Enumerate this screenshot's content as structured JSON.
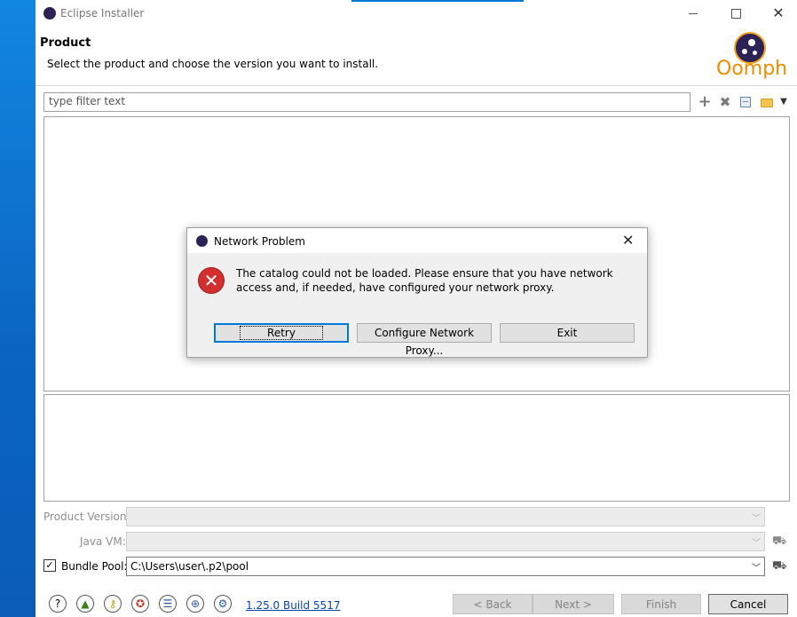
{
  "window": {
    "title": "Eclipse Installer"
  },
  "header": {
    "title": "Product",
    "description": "Select the product and choose the version you want to install.",
    "logo_text": "Oomph"
  },
  "filter": {
    "placeholder": "type filter text"
  },
  "fields": {
    "product_version_label": "Product Version:",
    "java_vm_label": "Java VM:",
    "bundle_pool_label": "Bundle Pool:",
    "bundle_pool_value": "C:\\Users\\user\\.p2\\pool",
    "bundle_pool_checked": true
  },
  "footer": {
    "version_link": "1.25.0 Build 5517",
    "back_label": "< Back",
    "next_label": "Next >",
    "finish_label": "Finish",
    "cancel_label": "Cancel"
  },
  "dialog": {
    "title": "Network Problem",
    "message": "The catalog could not be loaded. Please ensure that you have network access and, if needed, have configured your network proxy.",
    "retry_label": "Retry",
    "configure_label": "Configure Network Proxy...",
    "exit_label": "Exit"
  },
  "colors": {
    "accent": "#0078d7",
    "brand_orange": "#f08c00",
    "brand_purple": "#2c2255",
    "error_red": "#d32f2f",
    "link": "#0645ad"
  }
}
